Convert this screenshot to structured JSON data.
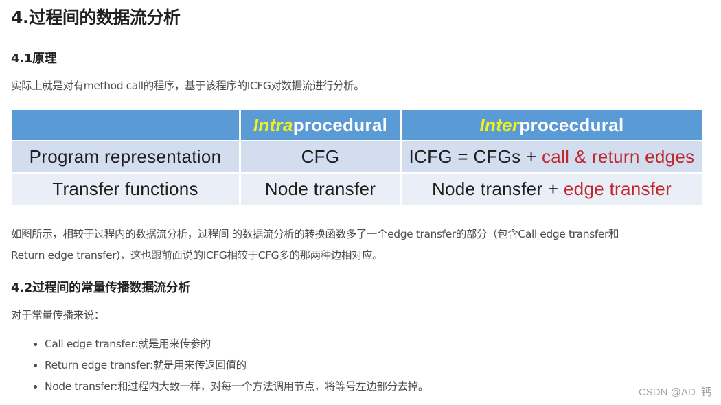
{
  "article": {
    "title": "4.过程间的数据流分析",
    "section1": {
      "heading": "4.1原理",
      "intro": "实际上就是对有method call的程序，基于该程序的ICFG对数据流进行分析。",
      "table": {
        "header": {
          "col0": "",
          "col1_highlight": "Intra",
          "col1_rest": "procedural",
          "col2_highlight": "Inter",
          "col2_rest": "procecdural"
        },
        "rows": [
          {
            "label": "Program representation",
            "intra": "CFG",
            "inter_plain": "ICFG = CFGs + ",
            "inter_red": "call & return edges"
          },
          {
            "label": "Transfer functions",
            "intra": "Node transfer",
            "inter_plain": "Node transfer + ",
            "inter_red": "edge transfer"
          }
        ]
      },
      "explanation_line1": "如图所示，相较于过程内的数据流分析，过程间 的数据流分析的转换函数多了一个edge transfer的部分（包含Call edge transfer和",
      "explanation_line2": "Return edge transfer)，这也跟前面说的ICFG相较于CFG多的那两种边相对应。"
    },
    "section2": {
      "heading": "4.2过程间的常量传播数据流分析",
      "intro": "对于常量传播来说：",
      "bullets": [
        "Call edge transfer:就是用来传参的",
        "Return edge transfer:就是用来传返回值的",
        "Node transfer:和过程内大致一样，对每一个方法调用节点，将等号左边部分去掉。"
      ]
    }
  },
  "watermark": "CSDN @AD_钙",
  "colors": {
    "table_header": "#5b9bd5",
    "table_row_odd": "#d2deef",
    "table_row_even": "#eaeff7",
    "highlight_yellow": "#f2f21a",
    "emphasis_red": "#c0282e"
  }
}
